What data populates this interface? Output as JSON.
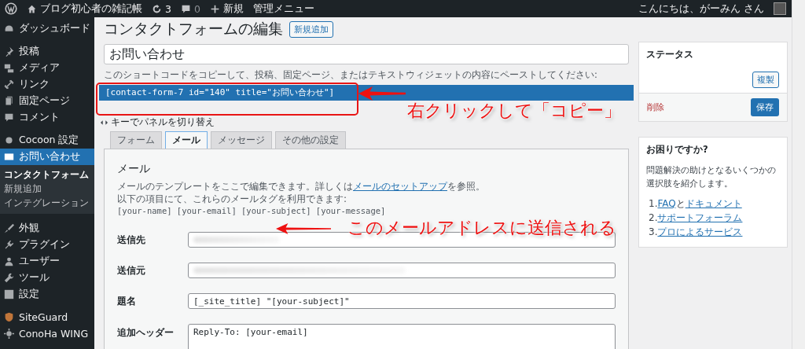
{
  "admin_bar": {
    "site_name": "ブログ初心者の雑記帳",
    "updates": "3",
    "comments": "0",
    "new_label": "新規",
    "admin_menu": "管理メニュー",
    "greeting": "こんにちは、がーみん さん"
  },
  "sidebar": {
    "items": [
      {
        "label": "ダッシュボード",
        "selected": false
      },
      {
        "label": "投稿",
        "selected": false
      },
      {
        "label": "メディア",
        "selected": false
      },
      {
        "label": "リンク",
        "selected": false
      },
      {
        "label": "固定ページ",
        "selected": false
      },
      {
        "label": "コメント",
        "selected": false
      },
      {
        "label": "Cocoon 設定",
        "selected": false
      },
      {
        "label": "お問い合わせ",
        "selected": true,
        "children": [
          {
            "label": "コンタクトフォーム",
            "selected": true
          },
          {
            "label": "新規追加",
            "selected": false
          },
          {
            "label": "インテグレーション",
            "selected": false
          }
        ]
      },
      {
        "label": "外観",
        "selected": false
      },
      {
        "label": "プラグイン",
        "selected": false
      },
      {
        "label": "ユーザー",
        "selected": false
      },
      {
        "label": "ツール",
        "selected": false
      },
      {
        "label": "設定",
        "selected": false
      },
      {
        "label": "SiteGuard",
        "selected": false
      },
      {
        "label": "ConoHa WING",
        "selected": false
      }
    ]
  },
  "page": {
    "title": "コンタクトフォームの編集",
    "add_new": "新規追加",
    "form_title": "お問い合わせ",
    "shortcode_hint": "このショートコードをコピーして、投稿、固定ページ、またはテキストウィジェットの内容にペーストしてください:",
    "shortcode": "[contact-form-7 id=\"140\" title=\"お問い合わせ\"]",
    "key_toggle": "キーでパネルを切り替え",
    "tabs": [
      {
        "label": "フォーム",
        "selected": false
      },
      {
        "label": "メール",
        "selected": true
      },
      {
        "label": "メッセージ",
        "selected": false
      },
      {
        "label": "その他の設定",
        "selected": false
      }
    ],
    "mail": {
      "heading": "メール",
      "description_before": "メールのテンプレートをここで編集できます。詳しくは",
      "description_link": "メールのセットアップ",
      "description_after": "を参照。",
      "tags_intro": "以下の項目にて、これらのメールタグを利用できます:",
      "tags": "[your-name] [your-email] [your-subject] [your-message]",
      "fields": [
        {
          "label": "送信先",
          "kind": "blurred"
        },
        {
          "label": "送信元",
          "kind": "blurred"
        },
        {
          "label": "題名",
          "kind": "text",
          "value": "[_site_title] \"[your-subject]\""
        },
        {
          "label": "追加ヘッダー",
          "kind": "textarea",
          "value": "Reply-To: [your-email]"
        }
      ]
    }
  },
  "status_box": {
    "title": "ステータス",
    "duplicate": "複製",
    "delete": "削除",
    "save": "保存"
  },
  "help_box": {
    "title": "お困りですか?",
    "text": "問題解決の助けとなるいくつかの選択肢を紹介します。",
    "links": [
      {
        "number": "1.",
        "parts": [
          "FAQ",
          "と",
          "ドキュメント"
        ]
      },
      {
        "number": "2.",
        "parts": [
          "サポートフォーラム"
        ]
      },
      {
        "number": "3.",
        "parts": [
          "プロによるサービス"
        ]
      }
    ]
  },
  "annotations": [
    {
      "text": "右クリックして「コピー」"
    },
    {
      "text": "このメールアドレスに送信される"
    }
  ]
}
